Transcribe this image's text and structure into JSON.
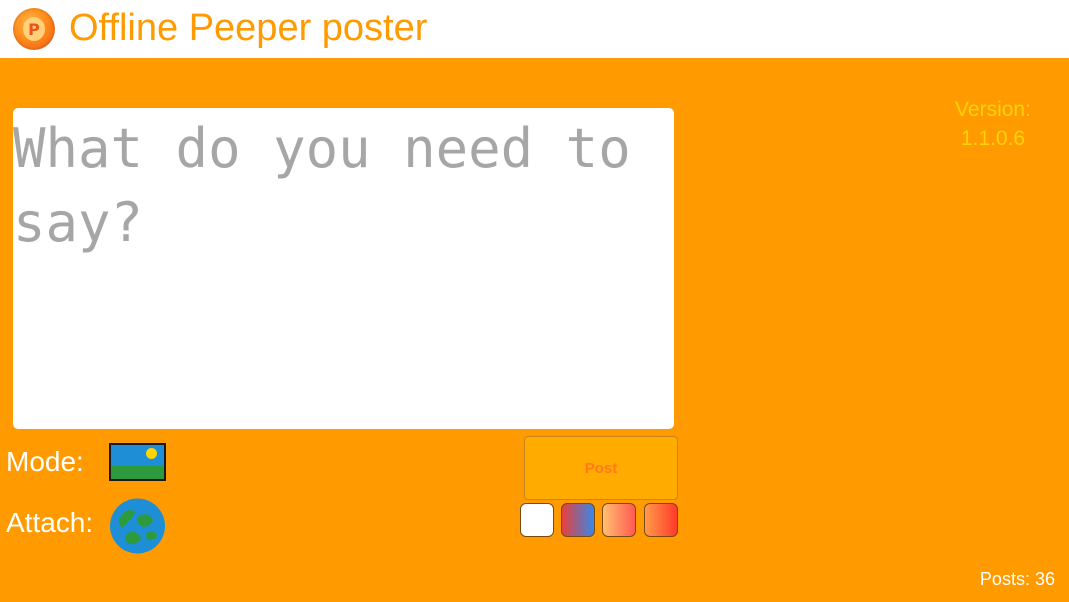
{
  "header": {
    "title": "Offline Peeper poster",
    "logo_icon": "peeper-logo-icon",
    "logo_letter": "P"
  },
  "compose": {
    "placeholder": "What do you need to say?",
    "value": ""
  },
  "version": {
    "label": "Version:",
    "number": "1.1.0.6"
  },
  "mode": {
    "label": "Mode:",
    "icon": "image-landscape-icon"
  },
  "attach": {
    "label": "Attach:",
    "icon": "globe-icon"
  },
  "post_button": {
    "label": "Post"
  },
  "color_swatches": [
    {
      "name": "white",
      "colors": [
        "#ffffff"
      ]
    },
    {
      "name": "red-blue",
      "colors": [
        "#e8413a",
        "#3a86e8"
      ]
    },
    {
      "name": "peach-red",
      "colors": [
        "#ffc070",
        "#ff5a52"
      ]
    },
    {
      "name": "orange-red",
      "colors": [
        "#ff9a4a",
        "#ff3a2a"
      ]
    }
  ],
  "footer": {
    "posts_label": "Posts:",
    "posts_count": "36"
  },
  "colors": {
    "brand_orange": "#ff9b00",
    "title_orange": "#ff9a00",
    "version_yellow": "#ffd200",
    "post_button_bg": "#ffab00"
  }
}
